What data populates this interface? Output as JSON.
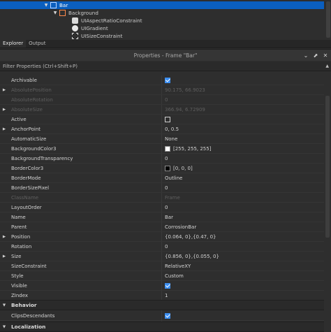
{
  "explorer": {
    "items": [
      {
        "label": "Bar",
        "icon": "frame-icon",
        "expanded": true,
        "selected": true
      },
      {
        "label": "Background",
        "icon": "frame-icon",
        "expanded": true,
        "selected": false
      },
      {
        "label": "UIAspectRatioConstraint",
        "icon": "constraint-icon"
      },
      {
        "label": "UIGradient",
        "icon": "gradient-icon"
      },
      {
        "label": "UISizeConstraint",
        "icon": "size-constraint-icon"
      }
    ]
  },
  "tabs": [
    {
      "label": "Explorer",
      "active": true
    },
    {
      "label": "Output",
      "active": false
    }
  ],
  "properties": {
    "title": "Properties - Frame \"Bar\"",
    "filter_placeholder": "Filter Properties (Ctrl+Shift+P)",
    "rows": [
      {
        "name": "Archivable",
        "type": "checkbox",
        "checked": true
      },
      {
        "name": "AbsolutePosition",
        "value": "90.175, 66.9023",
        "muted": true,
        "expandable": true
      },
      {
        "name": "AbsoluteRotation",
        "value": "0",
        "muted": true
      },
      {
        "name": "AbsoluteSize",
        "value": "366.94, 6.72909",
        "muted": true,
        "expandable": true
      },
      {
        "name": "Active",
        "type": "checkbox",
        "checked": false
      },
      {
        "name": "AnchorPoint",
        "value": "0, 0.5",
        "expandable": true
      },
      {
        "name": "AutomaticSize",
        "value": "None"
      },
      {
        "name": "BackgroundColor3",
        "value": "[255, 255, 255]",
        "swatch": "#ffffff"
      },
      {
        "name": "BackgroundTransparency",
        "value": "0"
      },
      {
        "name": "BorderColor3",
        "value": "[0, 0, 0]",
        "swatch": "#000000"
      },
      {
        "name": "BorderMode",
        "value": "Outline"
      },
      {
        "name": "BorderSizePixel",
        "value": "0"
      },
      {
        "name": "ClassName",
        "value": "Frame",
        "muted": true
      },
      {
        "name": "LayoutOrder",
        "value": "0"
      },
      {
        "name": "Name",
        "value": "Bar"
      },
      {
        "name": "Parent",
        "value": "CorrosionBar"
      },
      {
        "name": "Position",
        "value": "{0.064, 0},{0.47, 0}",
        "expandable": true
      },
      {
        "name": "Rotation",
        "value": "0"
      },
      {
        "name": "Size",
        "value": "{0.856, 0},{0.055, 0}",
        "expandable": true
      },
      {
        "name": "SizeConstraint",
        "value": "RelativeXY"
      },
      {
        "name": "Style",
        "value": "Custom"
      },
      {
        "name": "Visible",
        "type": "checkbox",
        "checked": true
      },
      {
        "name": "ZIndex",
        "value": "1"
      }
    ],
    "sections": [
      {
        "name": "Behavior"
      },
      {
        "name": "Localization"
      }
    ],
    "behavior_rows": [
      {
        "name": "ClipsDescendants",
        "type": "checkbox",
        "checked": true
      }
    ]
  },
  "colors": {
    "selection": "#0b5fbf",
    "checkbox_checked": "#3c8ef0",
    "frame_icon": "#ff8a4c"
  }
}
